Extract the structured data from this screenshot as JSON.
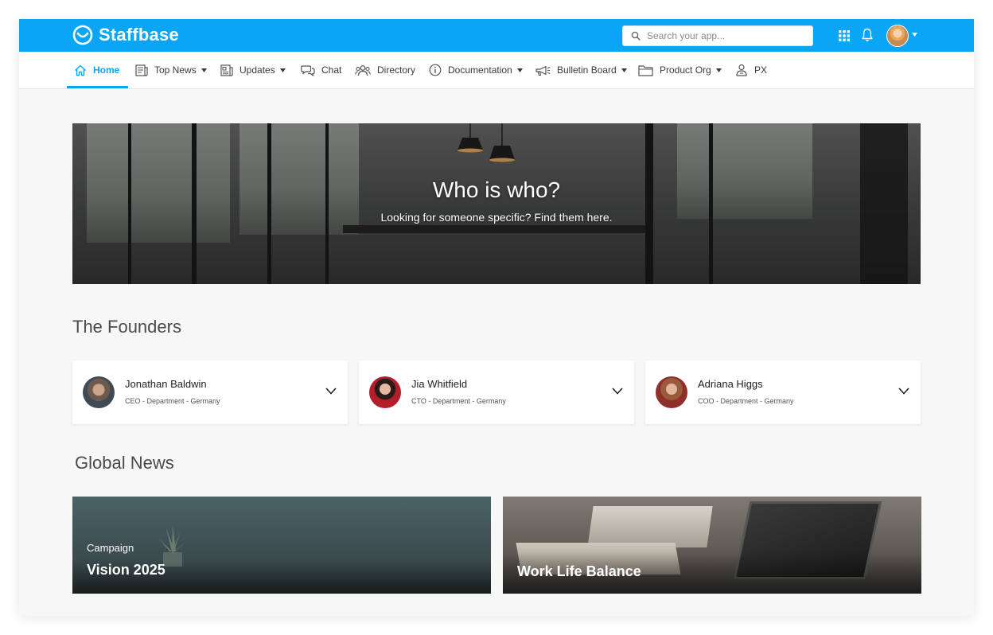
{
  "app": {
    "name": "Staffbase",
    "search_placeholder": "Search your app..."
  },
  "nav": {
    "items": [
      {
        "label": "Home",
        "icon": "home-icon",
        "has_menu": false,
        "active": true
      },
      {
        "label": "Top News",
        "icon": "newspaper-icon",
        "has_menu": true
      },
      {
        "label": "Updates",
        "icon": "updates-icon",
        "has_menu": true
      },
      {
        "label": "Chat",
        "icon": "chat-icon",
        "has_menu": false
      },
      {
        "label": "Directory",
        "icon": "people-icon",
        "has_menu": false
      },
      {
        "label": "Documentation",
        "icon": "info-icon",
        "has_menu": true
      },
      {
        "label": "Bulletin Board",
        "icon": "megaphone-icon",
        "has_menu": true
      },
      {
        "label": "Product Org",
        "icon": "folder-icon",
        "has_menu": true
      },
      {
        "label": "PX",
        "icon": "person-badge-icon",
        "has_menu": false
      }
    ]
  },
  "hero": {
    "title": "Who is who?",
    "subtitle": "Looking for someone specific? Find them here."
  },
  "founders": {
    "title": "The Founders",
    "people": [
      {
        "name": "Jonathan Baldwin",
        "meta": "CEO - Department - Germany"
      },
      {
        "name": "Jia Whitfield",
        "meta": "CTO - Department - Germany"
      },
      {
        "name": "Adriana Higgs",
        "meta": "COO - Department - Germany"
      }
    ]
  },
  "news": {
    "title": "Global News",
    "tiles": [
      {
        "kicker": "Campaign",
        "headline": "Vision 2025"
      },
      {
        "kicker": "",
        "headline": "Work Life Balance"
      }
    ]
  },
  "colors": {
    "brand": "#0aa5f5",
    "text": "#3a3a3a",
    "background": "#f7f7f7"
  }
}
